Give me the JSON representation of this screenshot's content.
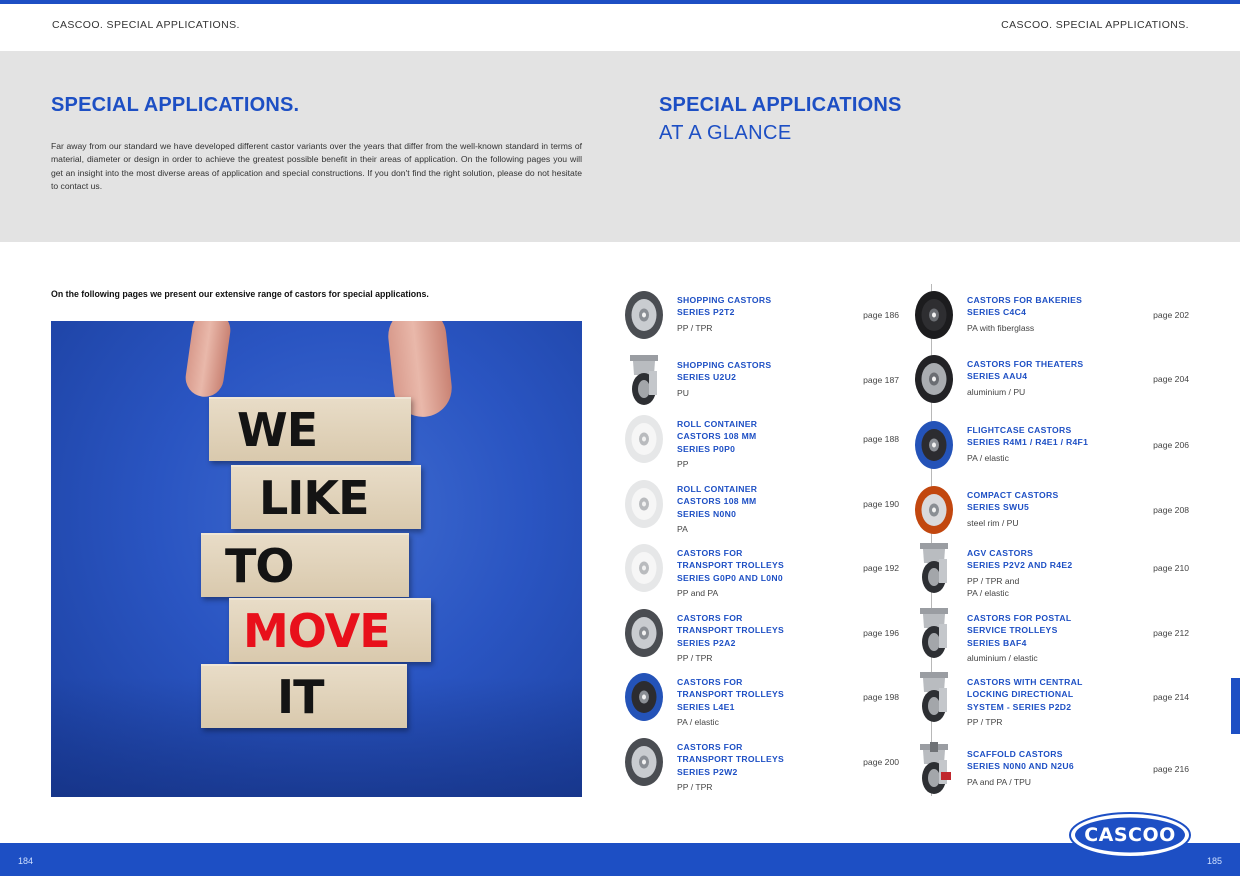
{
  "header": {
    "left": "CASCOO. SPECIAL APPLICATIONS.",
    "right": "CASCOO. SPECIAL APPLICATIONS."
  },
  "left_page": {
    "title": "SPECIAL APPLICATIONS.",
    "intro": "Far away from our standard we have developed different castor variants over the years that differ from the well-known standard in terms of material, diameter or design in order to achieve the greatest possible benefit in their areas of application. On the following pages you will get an insight into the most diverse areas of application and special constructions. If you don't find the right solution, please do not hesitate to contact us.",
    "lead": "On the following pages we present our extensive range of castors for special applications.",
    "photo_words": [
      "WE",
      "LIKE",
      "TO",
      "MOVE",
      "IT"
    ]
  },
  "right_page": {
    "title_line1": "SPECIAL APPLICATIONS",
    "title_line2": "AT A GLANCE"
  },
  "catalog": {
    "left_column": [
      {
        "name": [
          "SHOPPING CASTORS",
          "SERIES P2T2"
        ],
        "material": [
          "PP / TPR"
        ],
        "page": "page 186",
        "thumb": "wheel-grey-dark"
      },
      {
        "name": [
          "SHOPPING CASTORS",
          "SERIES U2U2"
        ],
        "material": [
          "PU"
        ],
        "page": "page 187",
        "thumb": "swivel-castor"
      },
      {
        "name": [
          "ROLL CONTAINER",
          "CASTORS 108 MM",
          "SERIES P0P0"
        ],
        "material": [
          "PP"
        ],
        "page": "page 188",
        "thumb": "wheel-white"
      },
      {
        "name": [
          "ROLL CONTAINER",
          "CASTORS 108 MM",
          "SERIES N0N0"
        ],
        "material": [
          "PA"
        ],
        "page": "page 190",
        "thumb": "wheel-white"
      },
      {
        "name": [
          "CASTORS FOR",
          "TRANSPORT TROLLEYS",
          "SERIES G0P0 AND L0N0"
        ],
        "material": [
          "PP and PA"
        ],
        "page": "page 192",
        "thumb": "wheel-white"
      },
      {
        "name": [
          "CASTORS FOR",
          "TRANSPORT TROLLEYS",
          "SERIES P2A2"
        ],
        "material": [
          "PP / TPR"
        ],
        "page": "page 196",
        "thumb": "wheel-grey-dark"
      },
      {
        "name": [
          "CASTORS FOR",
          "TRANSPORT TROLLEYS",
          "SERIES L4E1"
        ],
        "material": [
          "PA / elastic"
        ],
        "page": "page 198",
        "thumb": "wheel-blue"
      },
      {
        "name": [
          "CASTORS FOR",
          "TRANSPORT TROLLEYS",
          "SERIES P2W2"
        ],
        "material": [
          "PP / TPR"
        ],
        "page": "page 200",
        "thumb": "wheel-grey-dark"
      }
    ],
    "right_column": [
      {
        "name": [
          "CASTORS FOR BAKERIES",
          "SERIES C4C4"
        ],
        "material": [
          "PA with fiberglass"
        ],
        "page": "page 202",
        "thumb": "wheel-black"
      },
      {
        "name": [
          "CASTORS FOR THEATERS",
          "SERIES AAU4"
        ],
        "material": [
          "aluminium / PU"
        ],
        "page": "page 204",
        "thumb": "wheel-black-alu"
      },
      {
        "name": [
          "FLIGHTCASE CASTORS",
          "SERIES R4M1 / R4E1 / R4F1"
        ],
        "material": [
          "PA / elastic"
        ],
        "page": "page 206",
        "thumb": "wheel-blue"
      },
      {
        "name": [
          "COMPACT CASTORS",
          "SERIES SWU5"
        ],
        "material": [
          "steel rim / PU"
        ],
        "page": "page 208",
        "thumb": "wheel-orange"
      },
      {
        "name": [
          "AGV CASTORS",
          "SERIES P2V2 AND R4E2"
        ],
        "material": [
          "PP / TPR and",
          "PA / elastic"
        ],
        "page": "page 210",
        "thumb": "swivel-castor"
      },
      {
        "name": [
          "CASTORS FOR POSTAL",
          "SERVICE TROLLEYS",
          "SERIES BAF4"
        ],
        "material": [
          "aluminium / elastic"
        ],
        "page": "page 212",
        "thumb": "swivel-castor"
      },
      {
        "name": [
          "CASTORS WITH CENTRAL",
          "LOCKING DIRECTIONAL",
          "SYSTEM - SERIES P2D2"
        ],
        "material": [
          "PP / TPR"
        ],
        "page": "page 214",
        "thumb": "swivel-castor"
      },
      {
        "name": [
          "SCAFFOLD CASTORS",
          "SERIES N0N0 AND N2U6"
        ],
        "material": [
          "PA and PA / TPU"
        ],
        "page": "page 216",
        "thumb": "scaffold-castor"
      }
    ]
  },
  "footer": {
    "page_left": "184",
    "page_right": "185",
    "logo_text": "CASCOO"
  },
  "colors": {
    "brand_blue": "#1d4fc4",
    "band_grey": "#e3e3e3",
    "move_red": "#e8101b"
  }
}
